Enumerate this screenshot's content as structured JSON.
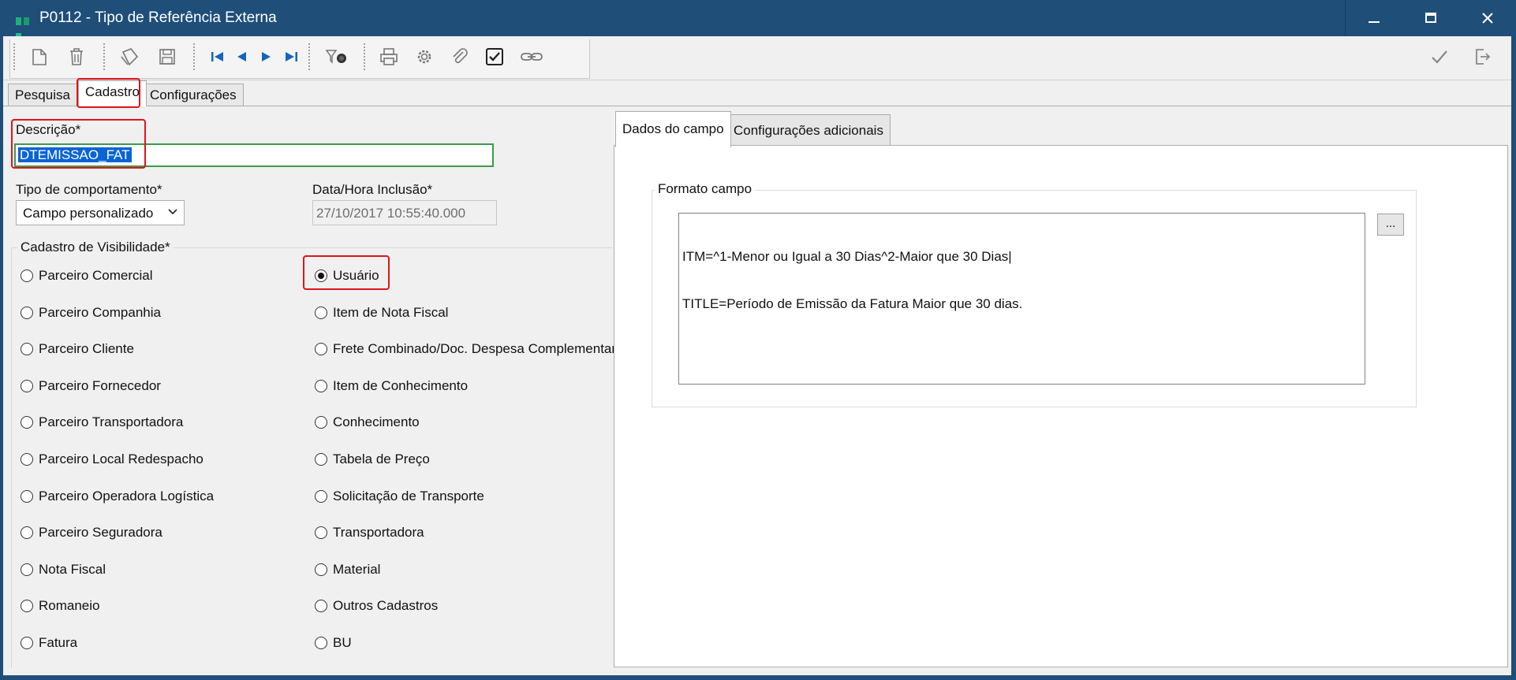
{
  "window": {
    "title": "P0112 - Tipo de Referência Externa"
  },
  "tabs": [
    {
      "label": "Pesquisa"
    },
    {
      "label": "Cadastro"
    },
    {
      "label": "Configurações"
    }
  ],
  "form": {
    "descricao_label": "Descrição*",
    "descricao_value": "DTEMISSAO_FAT",
    "tipo_label": "Tipo de comportamento*",
    "tipo_value": "Campo personalizado",
    "data_label": "Data/Hora Inclusão*",
    "data_value": "27/10/2017 10:55:40.000",
    "visibilidade_label": "Cadastro de Visibilidade*",
    "selected_option": "Usuário",
    "options_left": [
      "Parceiro Comercial",
      "Parceiro Companhia",
      "Parceiro Cliente",
      "Parceiro Fornecedor",
      "Parceiro Transportadora",
      "Parceiro Local Redespacho",
      "Parceiro Operadora Logística",
      "Parceiro Seguradora",
      "Nota Fiscal",
      "Romaneio",
      "Fatura"
    ],
    "options_right": [
      "Usuário",
      "Item de Nota Fiscal",
      "Frete Combinado/Doc. Despesa Complementar",
      "Item de Conhecimento",
      "Conhecimento",
      "Tabela de Preço",
      "Solicitação de Transporte",
      "Transportadora",
      "Material",
      "Outros Cadastros",
      "BU"
    ]
  },
  "right_panel": {
    "tabs": [
      {
        "label": "Dados do campo"
      },
      {
        "label": "Configurações adicionais"
      }
    ],
    "formato_label": "Formato campo",
    "formato_lines": [
      "ITM=^1-Menor ou Igual a 30 Dias^2-Maior que 30 Dias|",
      "TITLE=Período de Emissão da Fatura Maior que 30 dias."
    ],
    "ellipsis_label": "..."
  },
  "toolbar": {
    "icons": [
      "new-document-icon",
      "delete-icon",
      "copy-icon",
      "save-icon",
      "first-record-icon",
      "previous-record-icon",
      "next-record-icon",
      "last-record-icon",
      "search-filter-icon",
      "print-icon",
      "settings-icon",
      "attach-icon",
      "checkbox-icon",
      "link-icon",
      "confirm-icon",
      "exit-icon"
    ]
  },
  "colors": {
    "titlebar": "#1f4e79",
    "highlight_red": "#e0141a",
    "selection_blue": "#0a64d6",
    "input_focus_green": "#3c9a4b",
    "nav_blue": "#1565c0"
  }
}
